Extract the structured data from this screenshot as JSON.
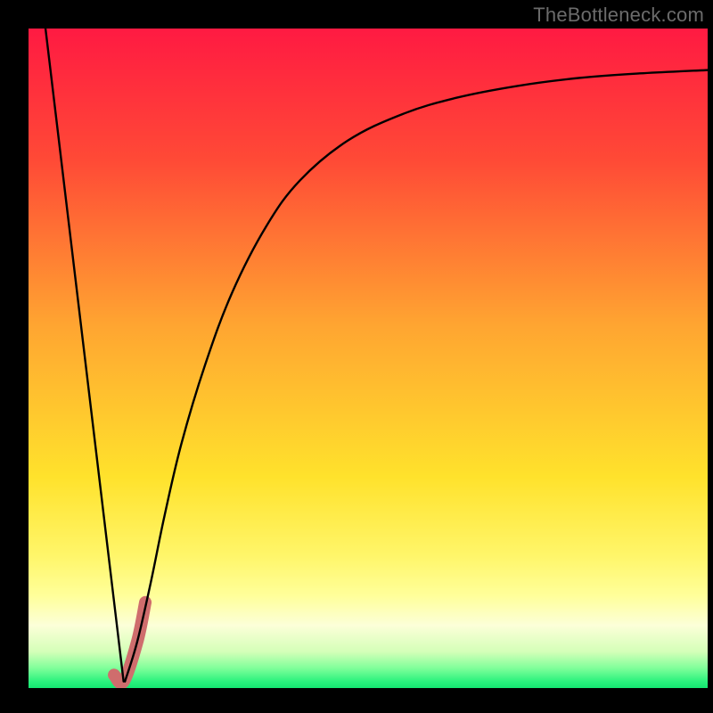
{
  "watermark": {
    "text": "TheBottleneck.com"
  },
  "chart_data": {
    "type": "line",
    "title": "",
    "xlabel": "",
    "ylabel": "",
    "ylim": [
      0,
      100
    ],
    "xlim": [
      0,
      100
    ],
    "gradient_stops": [
      {
        "offset": 0,
        "color": "#ff1a42"
      },
      {
        "offset": 0.2,
        "color": "#ff4a36"
      },
      {
        "offset": 0.45,
        "color": "#ffa531"
      },
      {
        "offset": 0.68,
        "color": "#ffe22c"
      },
      {
        "offset": 0.8,
        "color": "#fff66a"
      },
      {
        "offset": 0.86,
        "color": "#ffff9a"
      },
      {
        "offset": 0.905,
        "color": "#fcffd8"
      },
      {
        "offset": 0.945,
        "color": "#d4ffb8"
      },
      {
        "offset": 0.97,
        "color": "#7fff9a"
      },
      {
        "offset": 0.99,
        "color": "#2bf27d"
      },
      {
        "offset": 1.0,
        "color": "#14e772"
      }
    ],
    "series": [
      {
        "name": "left-arm",
        "x": [
          2.5,
          14.0
        ],
        "values": [
          100.0,
          1.0
        ]
      },
      {
        "name": "right-arm",
        "x": [
          14.2,
          16.0,
          18.0,
          20.0,
          22.5,
          26.0,
          30.0,
          35.0,
          40.0,
          47.0,
          55.0,
          63.0,
          72.0,
          81.0,
          90.0,
          100.0
        ],
        "values": [
          1.0,
          7.0,
          16.0,
          26.0,
          37.0,
          49.0,
          60.0,
          70.0,
          77.0,
          83.0,
          87.0,
          89.5,
          91.3,
          92.5,
          93.2,
          93.7
        ]
      }
    ],
    "highlight_segment": {
      "name": "recommended-range",
      "color": "#cf6d6d",
      "x": [
        12.6,
        14.0,
        16.0,
        17.2
      ],
      "values": [
        2.0,
        1.0,
        7.0,
        13.0
      ]
    }
  }
}
